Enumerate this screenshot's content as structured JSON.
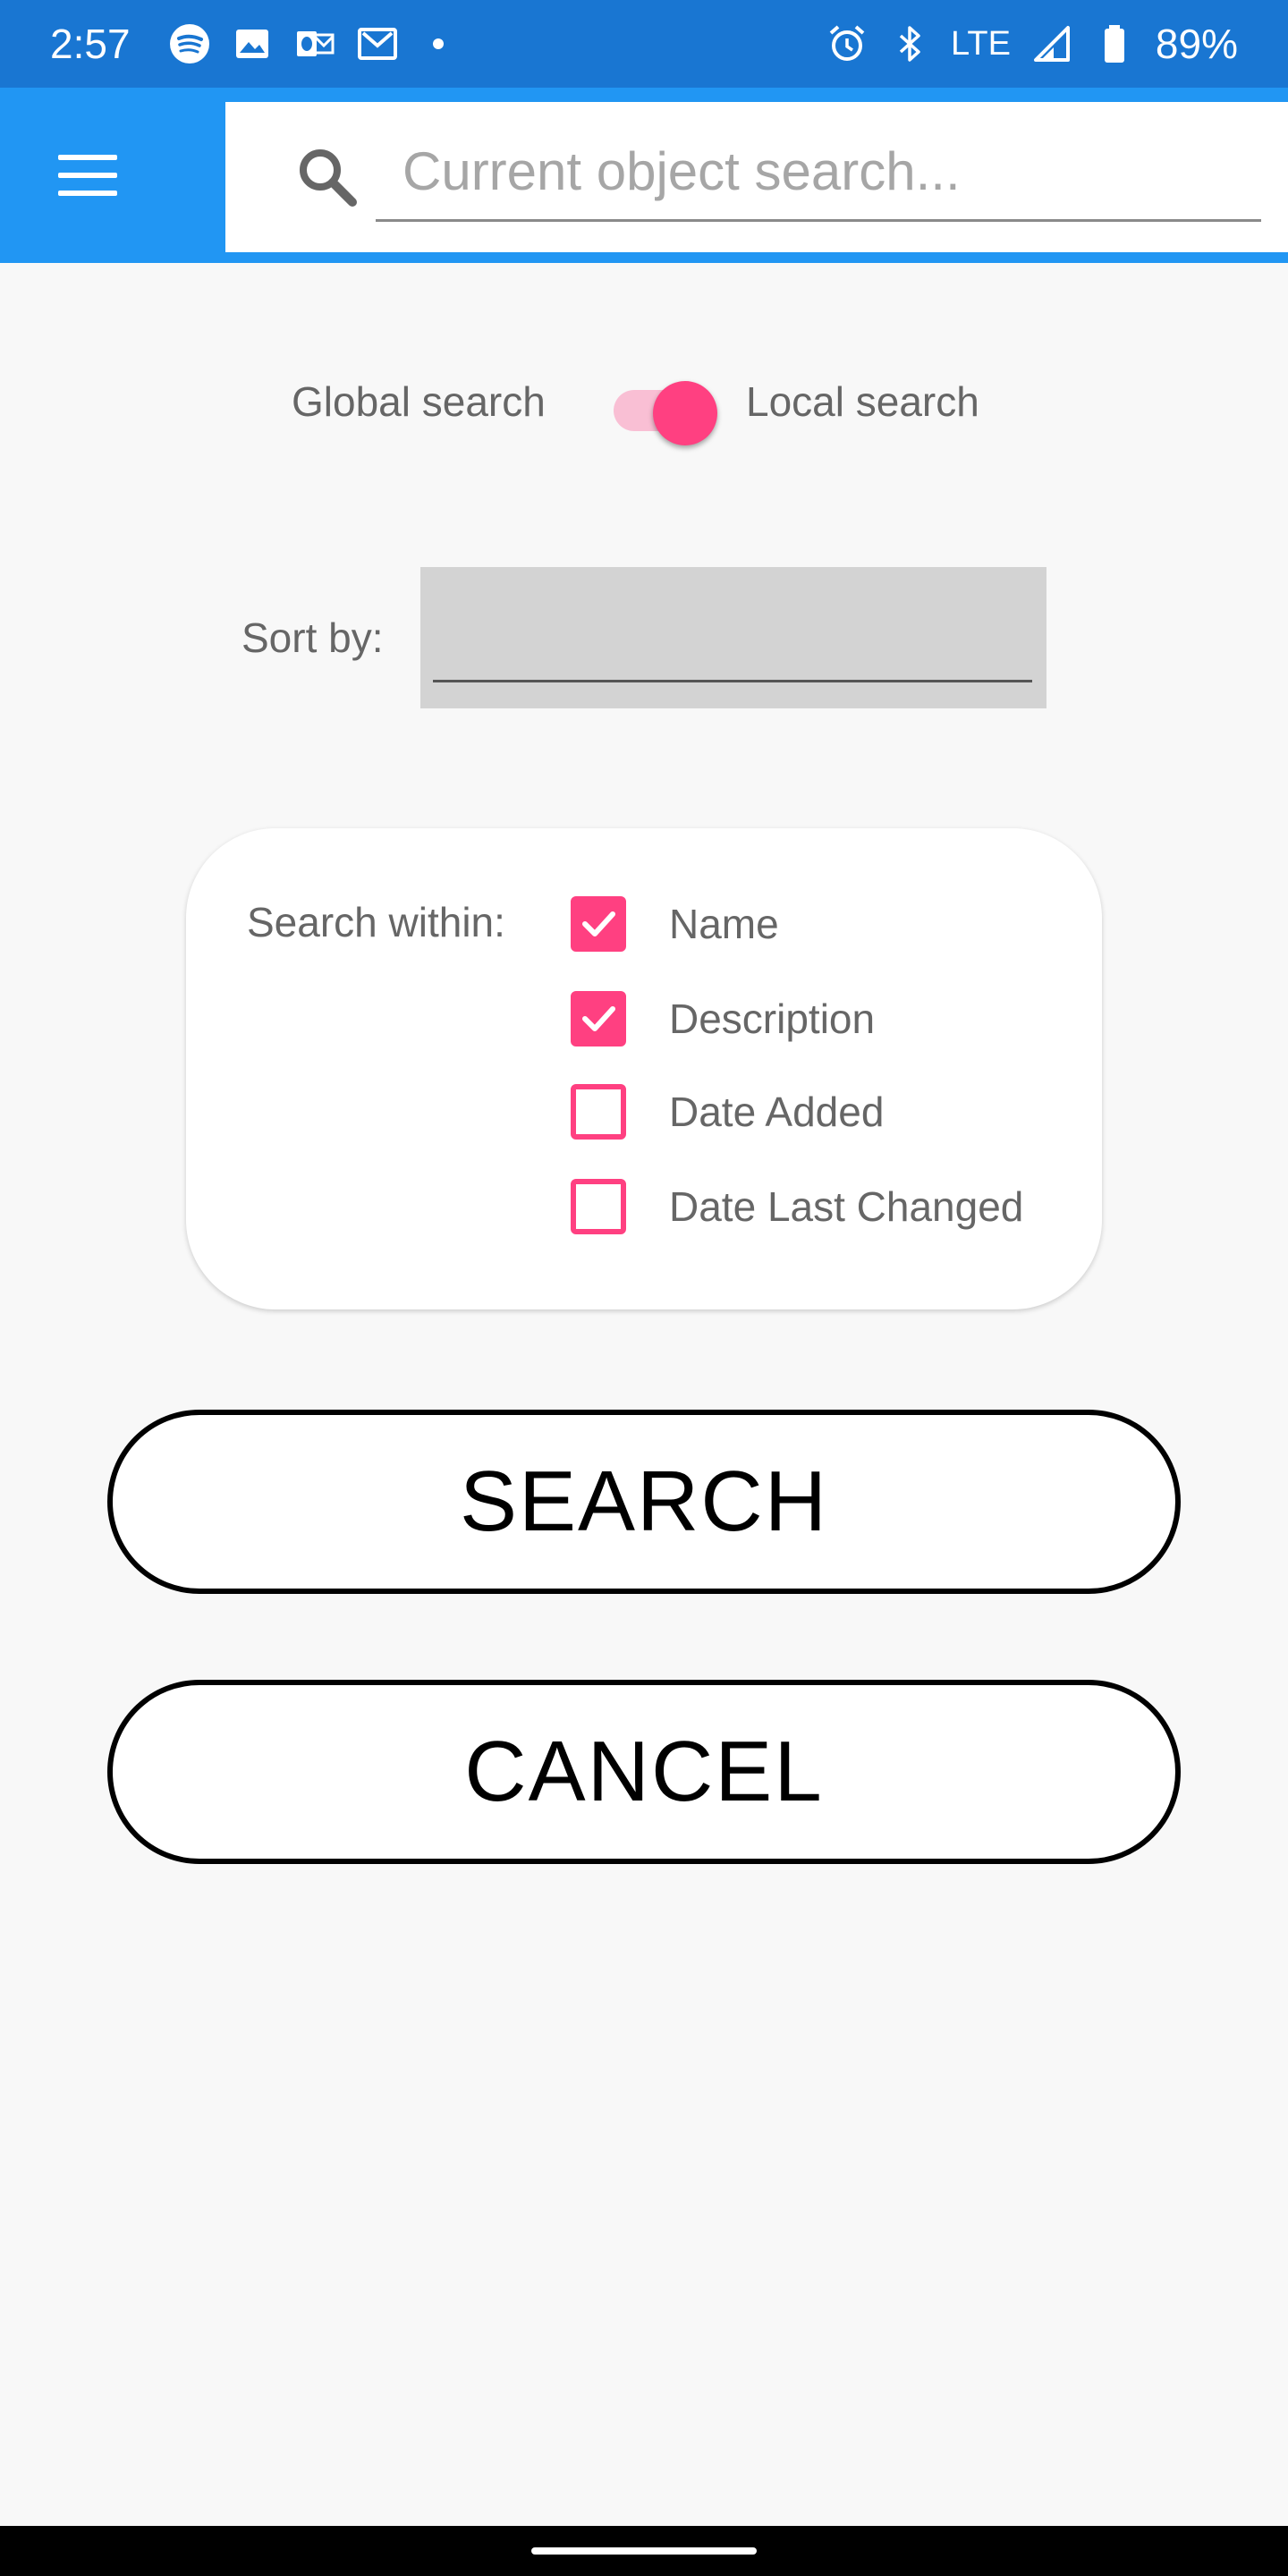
{
  "status_bar": {
    "time": "2:57",
    "network": "LTE",
    "battery": "89%",
    "left_icons": [
      "spotify-icon",
      "gallery-icon",
      "outlook-icon",
      "gmail-icon"
    ],
    "right_icons": [
      "alarm-icon",
      "bluetooth-icon",
      "signal-icon",
      "battery-icon"
    ]
  },
  "app_bar": {
    "color": "#2196f3",
    "search_placeholder": "Current object search...",
    "search_value": ""
  },
  "scope_toggle": {
    "left_label": "Global search",
    "right_label": "Local search",
    "selected": "Local search"
  },
  "sort": {
    "label": "Sort by:",
    "value": ""
  },
  "search_within": {
    "label": "Search within:",
    "options": [
      {
        "label": "Name",
        "checked": true
      },
      {
        "label": "Description",
        "checked": true
      },
      {
        "label": "Date Added",
        "checked": false
      },
      {
        "label": "Date Last Changed",
        "checked": false
      }
    ]
  },
  "buttons": {
    "search": "SEARCH",
    "cancel": "CANCEL"
  },
  "colors": {
    "status_bar": "#1976d2",
    "accent": "#ff4081",
    "background": "#f8f8f8"
  }
}
